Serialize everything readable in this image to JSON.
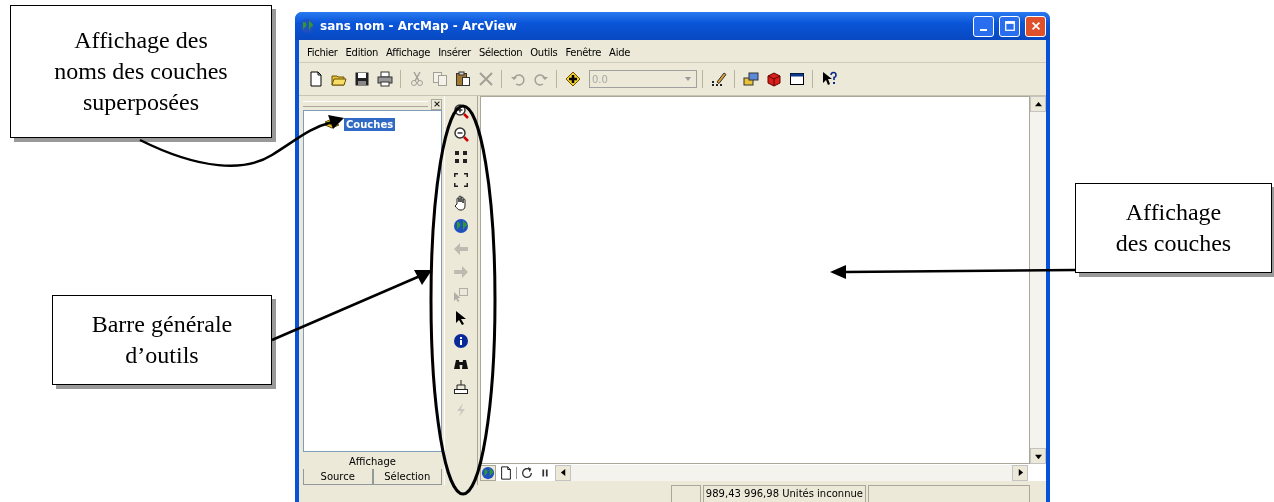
{
  "annotations": [
    {
      "lines": [
        "Affichage des",
        "noms des couches",
        "superposées"
      ]
    },
    {
      "lines": [
        "Barre générale",
        "d’outils"
      ]
    },
    {
      "lines": [
        "Affichage",
        "des couches"
      ]
    }
  ],
  "window": {
    "title": "sans nom - ArcMap - ArcView"
  },
  "menu": [
    "Fichier",
    "Edition",
    "Affichage",
    "Insérer",
    "Sélection",
    "Outils",
    "Fenêtre",
    "Aide"
  ],
  "toolbar": [
    {
      "kind": "new",
      "disabled": false
    },
    {
      "kind": "open",
      "disabled": false
    },
    {
      "kind": "save",
      "disabled": false
    },
    {
      "kind": "print",
      "disabled": false
    },
    {
      "kind": "separator"
    },
    {
      "kind": "cut",
      "disabled": true
    },
    {
      "kind": "copy",
      "disabled": true
    },
    {
      "kind": "paste",
      "disabled": false
    },
    {
      "kind": "delete",
      "disabled": true
    },
    {
      "kind": "separator"
    },
    {
      "kind": "undo",
      "disabled": true
    },
    {
      "kind": "redo",
      "disabled": true
    },
    {
      "kind": "separator"
    },
    {
      "kind": "add-data",
      "disabled": false
    },
    {
      "kind": "scale-combo",
      "value": "0.0",
      "disabled": true
    },
    {
      "kind": "separator"
    },
    {
      "kind": "editor",
      "disabled": false
    },
    {
      "kind": "separator"
    },
    {
      "kind": "toolbox",
      "disabled": false
    },
    {
      "kind": "model",
      "disabled": false
    },
    {
      "kind": "window",
      "disabled": false
    },
    {
      "kind": "separator"
    },
    {
      "kind": "help",
      "disabled": false
    }
  ],
  "toc": {
    "layers": [
      {
        "label": "Couches",
        "selected": true
      }
    ],
    "tabs": [
      {
        "label": "Affichage",
        "selected": true
      },
      {
        "label": "Source",
        "selected": false
      },
      {
        "label": "Sélection",
        "selected": false
      }
    ]
  },
  "tools": [
    {
      "kind": "zoom-in",
      "disabled": false
    },
    {
      "kind": "zoom-out",
      "disabled": false
    },
    {
      "kind": "fixed-zoom-in",
      "disabled": false
    },
    {
      "kind": "fixed-zoom-out",
      "disabled": false
    },
    {
      "kind": "pan",
      "disabled": false
    },
    {
      "kind": "full-extent",
      "disabled": false
    },
    {
      "kind": "back",
      "disabled": true
    },
    {
      "kind": "forward",
      "disabled": true
    },
    {
      "kind": "select-elements",
      "disabled": true
    },
    {
      "kind": "pointer",
      "disabled": false
    },
    {
      "kind": "identify",
      "disabled": false
    },
    {
      "kind": "find",
      "disabled": false
    },
    {
      "kind": "measure",
      "disabled": false
    },
    {
      "kind": "hyperlink",
      "disabled": true
    }
  ],
  "view_buttons": [
    {
      "kind": "data-view",
      "selected": true
    },
    {
      "kind": "layout-view",
      "selected": false
    },
    {
      "kind": "separator"
    },
    {
      "kind": "refresh"
    },
    {
      "kind": "pause"
    }
  ],
  "status_bar": {
    "coordinates": "989,43  996,98 Unités inconnue"
  }
}
